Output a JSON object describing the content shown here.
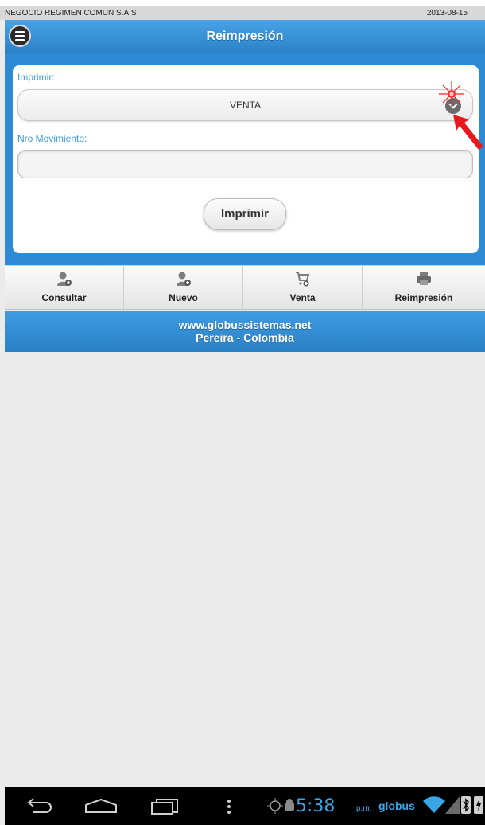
{
  "status_strip": {
    "company": "NEGOCIO REGIMEN COMUN S.A.S",
    "date": "2013-08-15"
  },
  "header": {
    "title": "Reimpresión",
    "menu_icon": "menu-icon"
  },
  "form": {
    "print_label": "Imprimir:",
    "print_select_value": "VENTA",
    "movement_label": "Nro Movimiento:",
    "movement_value": "",
    "print_button": "Imprimir"
  },
  "nav": {
    "items": [
      {
        "label": "Consultar",
        "icon": "user-search-icon"
      },
      {
        "label": "Nuevo",
        "icon": "user-add-icon"
      },
      {
        "label": "Venta",
        "icon": "cart-add-icon"
      },
      {
        "label": "Reimpresión",
        "icon": "printer-icon"
      }
    ]
  },
  "footer": {
    "line1": "www.globussistemas.net",
    "line2": "Pereira - Colombia"
  },
  "system_bar": {
    "time": "5:38",
    "ampm": "p.m.",
    "carrier": "globus"
  },
  "colors": {
    "accent": "#2c8bd4",
    "header": "#3a95dc",
    "label": "#3a9be0",
    "clock": "#3aa6e6"
  }
}
